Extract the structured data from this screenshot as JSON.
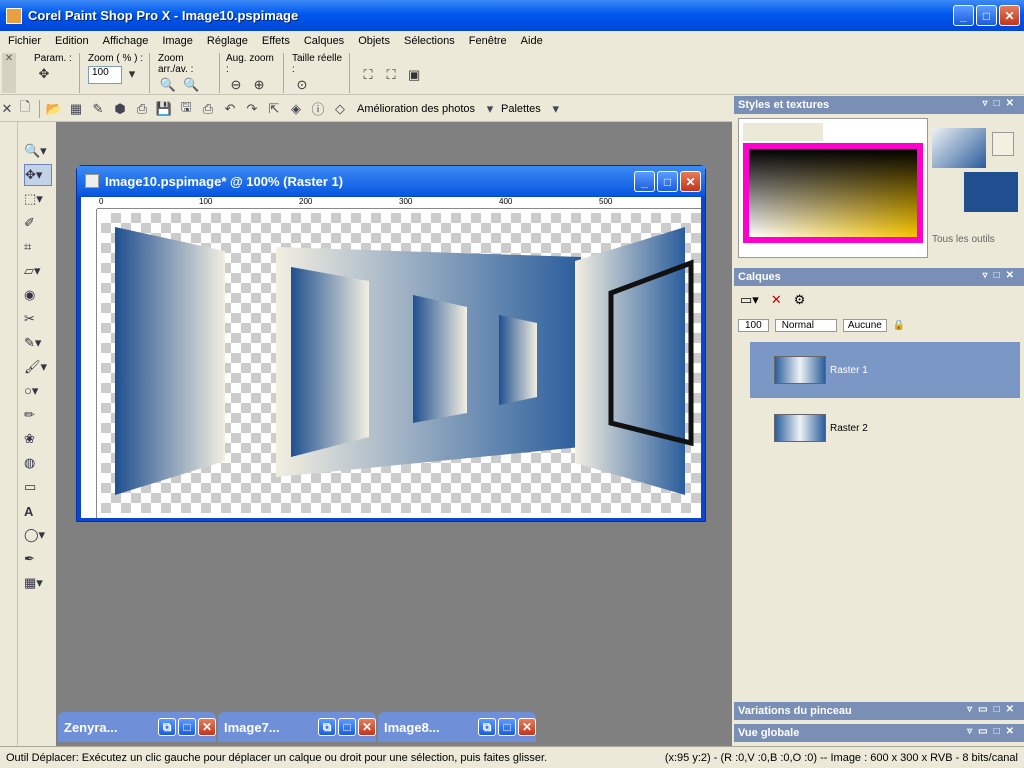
{
  "window": {
    "title": "Corel Paint Shop Pro X - Image10.pspimage"
  },
  "menu": [
    "Fichier",
    "Edition",
    "Affichage",
    "Image",
    "Réglage",
    "Effets",
    "Calques",
    "Objets",
    "Sélections",
    "Fenêtre",
    "Aide"
  ],
  "toolbar1": {
    "param_label": "Param. :",
    "zoom_label": "Zoom ( % ) :",
    "zoom_value": "100",
    "zoom_arr_label": "Zoom arr./av. :",
    "aug_zoom_label": "Aug. zoom :",
    "taille_reelle_label": "Taille réelle :"
  },
  "toolbar2": {
    "amelioration_label": "Amélioration des photos",
    "palettes_label": "Palettes"
  },
  "image_window": {
    "title": "Image10.pspimage* @ 100% (Raster 1)",
    "ruler_ticks": [
      "0",
      "100",
      "200",
      "300",
      "400",
      "500"
    ]
  },
  "minimized_windows": [
    "Zenyra...",
    "Image7...",
    "Image8..."
  ],
  "styles_panel": {
    "title": "Styles et textures",
    "all_tools_label": "Tous les outils"
  },
  "layers_panel": {
    "title": "Calques",
    "opacity": "100",
    "blend_mode": "Normal",
    "mask_label": "Aucune",
    "layers": [
      "Raster 1",
      "Raster 2"
    ]
  },
  "brush_panel": {
    "title": "Variations du pinceau"
  },
  "overview_panel": {
    "title": "Vue globale"
  },
  "status": {
    "left": "Outil Déplacer: Exécutez un clic gauche pour déplacer un calque ou droit pour une sélection, puis faites glisser.",
    "right": "(x:95 y:2) - (R :0,V :0,B :0,O :0) -- Image : 600 x 300 x RVB - 8 bits/canal"
  },
  "colors": {
    "accent": "#0a46d0",
    "panel_head": "#7a8fb6",
    "layer_selected": "#7b97c5",
    "fg_swatch": "#1f4f8f",
    "bg_swatch": "#f3efe1"
  }
}
